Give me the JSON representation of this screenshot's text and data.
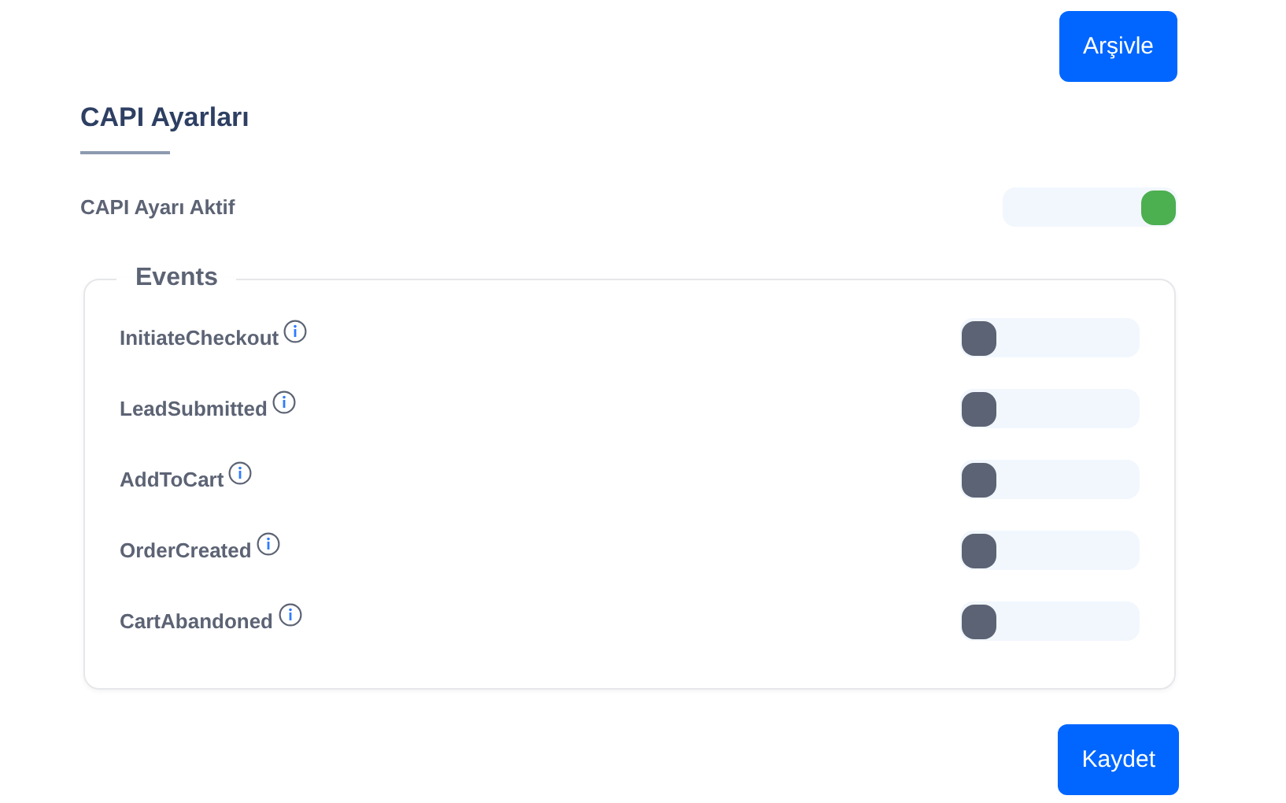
{
  "archive_button": "Arşivle",
  "section": {
    "title": "CAPI Ayarları"
  },
  "capi_active": {
    "label": "CAPI Ayarı Aktif",
    "on": true
  },
  "events": {
    "legend": "Events",
    "items": [
      {
        "name": "InitiateCheckout",
        "on": false
      },
      {
        "name": "LeadSubmitted",
        "on": false
      },
      {
        "name": "AddToCart",
        "on": false
      },
      {
        "name": "OrderCreated",
        "on": false
      },
      {
        "name": "CartAbandoned",
        "on": false
      }
    ]
  },
  "save_button": "Kaydet"
}
